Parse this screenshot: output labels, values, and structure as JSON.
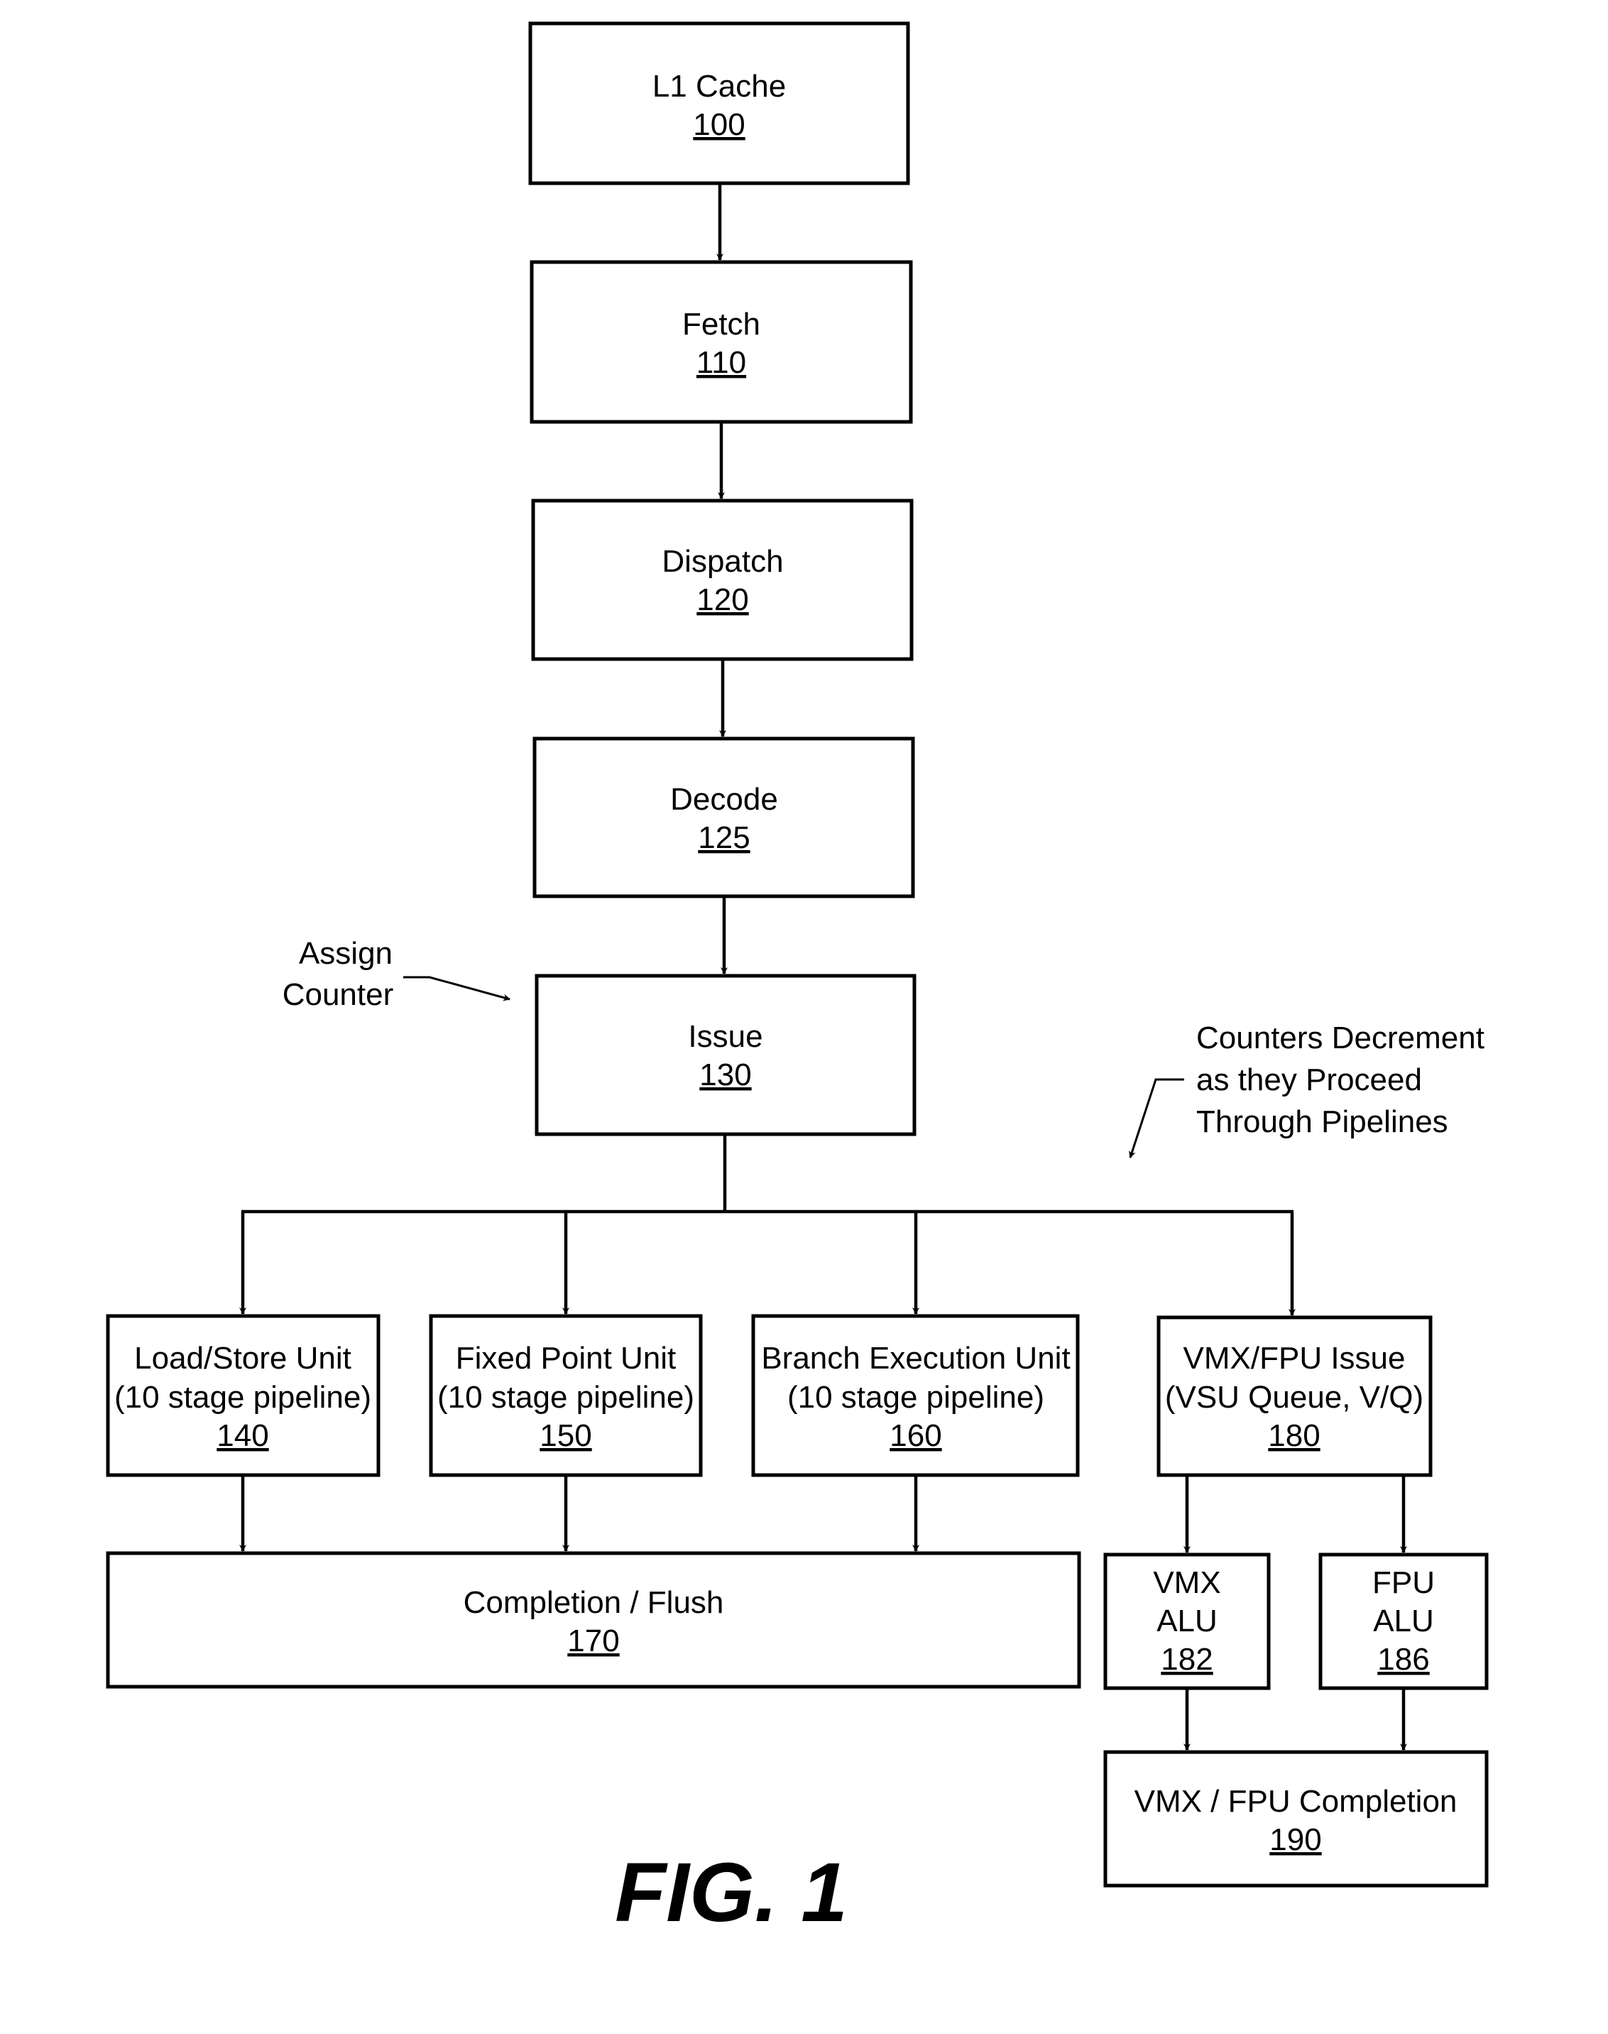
{
  "figure": {
    "label": "FIG. 1"
  },
  "blocks": {
    "l1_cache": {
      "title": "L1 Cache",
      "ref": "100"
    },
    "fetch": {
      "title": "Fetch",
      "ref": "110"
    },
    "dispatch": {
      "title": "Dispatch",
      "ref": "120"
    },
    "decode": {
      "title": "Decode",
      "ref": "125"
    },
    "issue": {
      "title": "Issue",
      "ref": "130"
    },
    "load_store": {
      "title": "Load/Store Unit",
      "subtitle": "(10 stage pipeline)",
      "ref": "140"
    },
    "fixed_point": {
      "title": "Fixed Point Unit",
      "subtitle": "(10 stage pipeline)",
      "ref": "150"
    },
    "branch": {
      "title": "Branch Execution Unit",
      "subtitle": "(10 stage pipeline)",
      "ref": "160"
    },
    "vmx_fpu_issue": {
      "title": "VMX/FPU Issue",
      "subtitle": "(VSU Queue, V/Q)",
      "ref": "180"
    },
    "completion": {
      "title": "Completion / Flush",
      "ref": "170"
    },
    "vmx_alu": {
      "title": "VMX",
      "subtitle": "ALU",
      "ref": "182"
    },
    "fpu_alu": {
      "title": "FPU",
      "subtitle": "ALU",
      "ref": "186"
    },
    "vmx_fpu_completion": {
      "title": "VMX / FPU Completion",
      "ref": "190"
    }
  },
  "annotations": {
    "assign_counter": [
      "Assign",
      "Counter"
    ],
    "counters_decrement": [
      "Counters Decrement",
      "as they Proceed",
      "Through Pipelines"
    ]
  }
}
